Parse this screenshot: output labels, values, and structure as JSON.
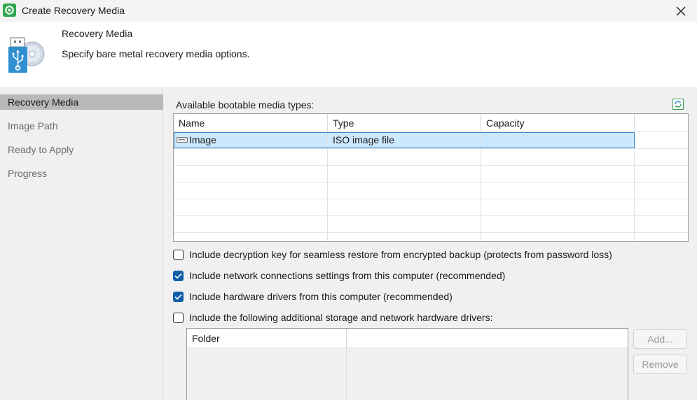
{
  "window": {
    "title": "Create Recovery Media",
    "close_icon": "close-icon",
    "app_icon": "veeam-agent-icon"
  },
  "header": {
    "title": "Recovery Media",
    "subtitle": "Specify bare metal recovery media options.",
    "icon": "usb-disc-icon"
  },
  "sidebar": {
    "items": [
      {
        "label": "Recovery Media",
        "active": true
      },
      {
        "label": "Image Path",
        "active": false
      },
      {
        "label": "Ready to Apply",
        "active": false
      },
      {
        "label": "Progress",
        "active": false
      }
    ]
  },
  "media": {
    "label": "Available bootable media types:",
    "refresh_icon": "refresh-icon",
    "columns": [
      "Name",
      "Type",
      "Capacity"
    ],
    "rows": [
      {
        "name": "Image",
        "type": "ISO image file",
        "capacity": "",
        "selected": true
      }
    ]
  },
  "options": [
    {
      "label": "Include decryption key for seamless restore from encrypted backup (protects from password loss)",
      "checked": false
    },
    {
      "label": "Include network connections settings from this computer (recommended)",
      "checked": true
    },
    {
      "label": "Include hardware drivers from this computer (recommended)",
      "checked": true
    },
    {
      "label": "Include the following additional storage and network hardware drivers:",
      "checked": false
    }
  ],
  "drivers": {
    "columns": [
      "Folder",
      ""
    ],
    "add_label": "Add...",
    "remove_label": "Remove"
  },
  "colors": {
    "selection": "#cce8ff",
    "checkbox_checked": "#0f5fa8",
    "sidebar_active": "#b9b9b9"
  }
}
